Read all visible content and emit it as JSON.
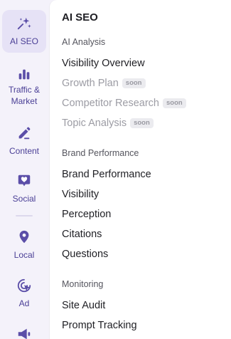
{
  "rail": {
    "items": [
      {
        "label": "AI SEO",
        "icon": "sparkles-icon",
        "active": true
      },
      {
        "label": "Traffic &\nMarket",
        "icon": "bar-chart-icon",
        "active": false
      },
      {
        "label": "Content",
        "icon": "pencil-icon",
        "active": false
      },
      {
        "label": "Social",
        "icon": "heart-bubble-icon",
        "active": false
      },
      {
        "label": "Local",
        "icon": "map-pin-icon",
        "active": false
      },
      {
        "label": "Ad",
        "icon": "cursor-target-icon",
        "active": false
      },
      {
        "label": "",
        "icon": "megaphone-icon",
        "active": false
      }
    ]
  },
  "panel": {
    "title": "AI SEO",
    "sections": [
      {
        "heading": "AI Analysis",
        "items": [
          {
            "label": "Visibility Overview",
            "badge": null,
            "disabled": false
          },
          {
            "label": "Growth Plan",
            "badge": "soon",
            "disabled": true
          },
          {
            "label": "Competitor Research",
            "badge": "soon",
            "disabled": true
          },
          {
            "label": "Topic Analysis",
            "badge": "soon",
            "disabled": true
          }
        ]
      },
      {
        "heading": "Brand Performance",
        "items": [
          {
            "label": "Brand Performance",
            "badge": null,
            "disabled": false
          },
          {
            "label": "Visibility",
            "badge": null,
            "disabled": false
          },
          {
            "label": "Perception",
            "badge": null,
            "disabled": false
          },
          {
            "label": "Citations",
            "badge": null,
            "disabled": false
          },
          {
            "label": "Questions",
            "badge": null,
            "disabled": false
          }
        ]
      },
      {
        "heading": "Monitoring",
        "items": [
          {
            "label": "Site Audit",
            "badge": null,
            "disabled": false
          },
          {
            "label": "Prompt Tracking",
            "badge": null,
            "disabled": false
          }
        ]
      }
    ]
  },
  "colors": {
    "accent": "#5b4ea8",
    "rail_background": "#f4f2fa",
    "active_background": "#e6e2f6",
    "disabled_text": "#9c9ca4",
    "badge_background": "#ebebef"
  }
}
